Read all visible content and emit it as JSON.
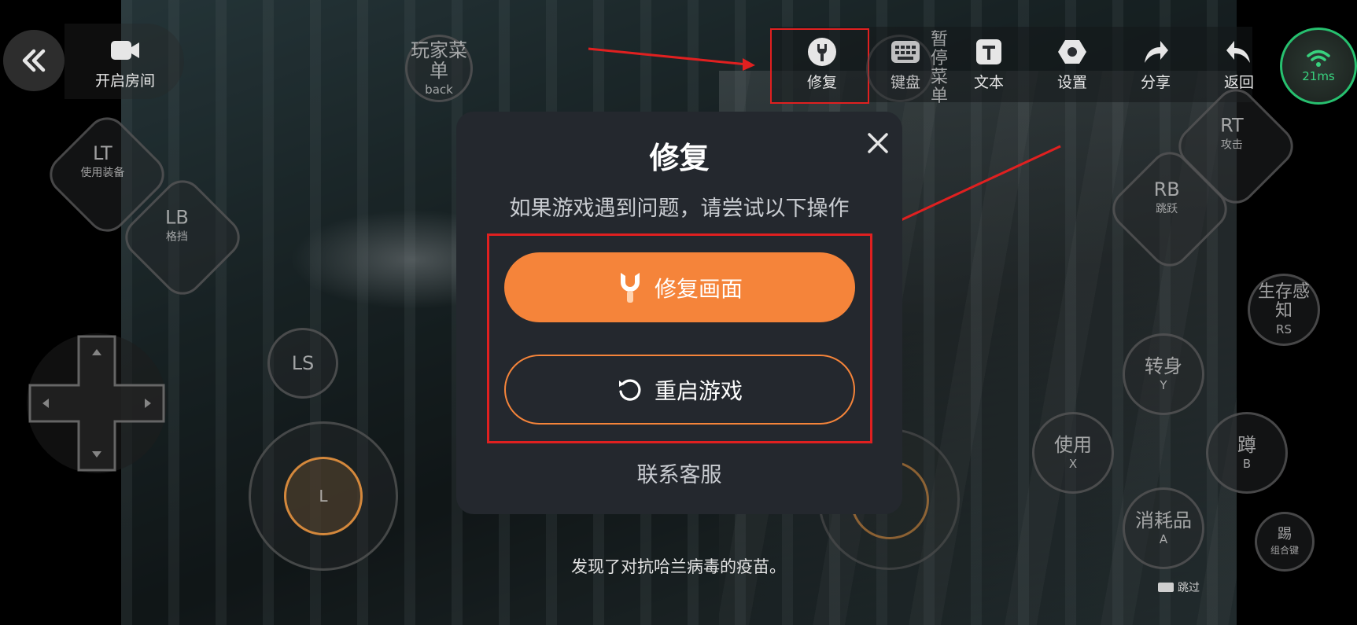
{
  "top_left": {
    "room_label": "开启房间"
  },
  "toolbar": {
    "items": [
      {
        "label": "修复",
        "icon": "wrench-icon"
      },
      {
        "label": "键盘",
        "icon": "keyboard-icon"
      },
      {
        "label": "文本",
        "icon": "text-icon"
      },
      {
        "label": "设置",
        "icon": "settings-icon"
      },
      {
        "label": "分享",
        "icon": "share-icon"
      },
      {
        "label": "返回",
        "icon": "back-icon"
      }
    ]
  },
  "network": {
    "latency": "21ms"
  },
  "controls": {
    "player_menu": {
      "main": "玩家菜单",
      "sub": "back"
    },
    "pause_menu": {
      "main": "暂停菜单"
    },
    "lt": {
      "main": "LT",
      "sub": "使用装备"
    },
    "lb": {
      "main": "LB",
      "sub": "格挡"
    },
    "rt": {
      "main": "RT",
      "sub": "攻击"
    },
    "rb": {
      "main": "RB",
      "sub": "跳跃"
    },
    "ls": {
      "main": "LS"
    },
    "l_stick": {
      "main": "L"
    },
    "rs": {
      "main": "生存感知",
      "sub": "RS"
    },
    "y": {
      "main": "转身",
      "sub": "Y"
    },
    "x": {
      "main": "使用",
      "sub": "X"
    },
    "b": {
      "main": "蹲",
      "sub": "B"
    },
    "a": {
      "main": "消耗品",
      "sub": "A"
    },
    "kick": {
      "main": "踢",
      "sub": "组合键"
    }
  },
  "dialog": {
    "title": "修复",
    "subtitle": "如果游戏遇到问题，请尝试以下操作",
    "repair_button": "修复画面",
    "restart_button": "重启游戏",
    "contact": "联系客服"
  },
  "game_caption": "发现了对抗哈兰病毒的疫苗。",
  "skip_label": "跳过",
  "colors": {
    "accent": "#f5843a",
    "dialog_bg": "#24282e",
    "highlight": "#e02020",
    "network": "#27c06f"
  }
}
